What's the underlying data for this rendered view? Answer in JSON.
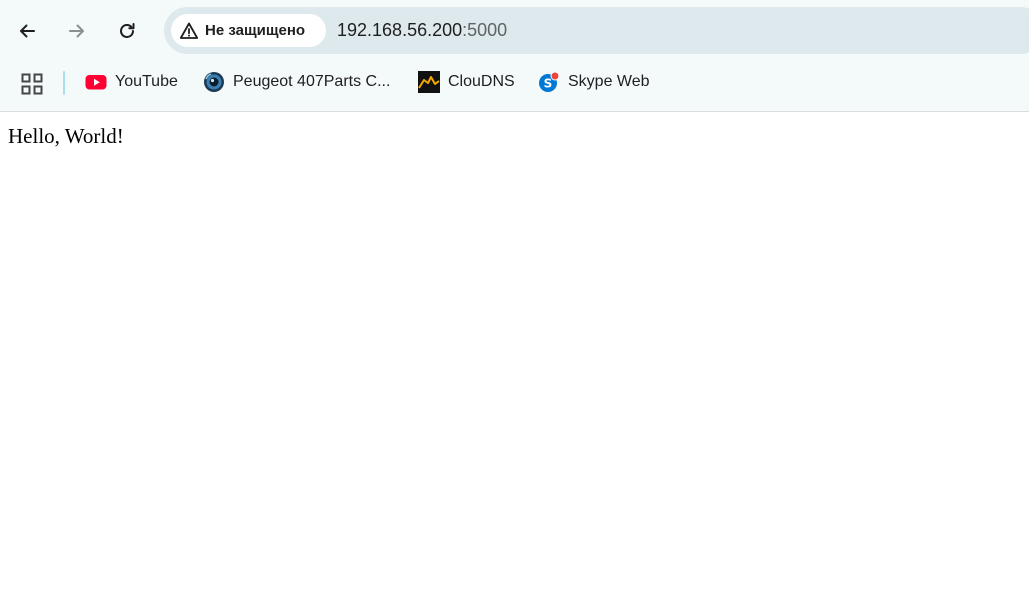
{
  "toolbar": {
    "security_label": "Не защищено",
    "url_host": "192.168.56.200",
    "url_port": ":5000"
  },
  "bookmarks": {
    "items": [
      {
        "label": "YouTube",
        "icon": "youtube-icon"
      },
      {
        "label": "Peugeot 407Parts C...",
        "icon": "peugeot-favicon"
      },
      {
        "label": "ClouDNS",
        "icon": "cloudns-favicon"
      },
      {
        "label": "Skype Web",
        "icon": "skype-icon"
      }
    ]
  },
  "page": {
    "text": "Hello, World!"
  },
  "colors": {
    "toolbar_bg": "#f4f9fa",
    "omnibox_bg": "#dde9ec",
    "youtube_red": "#ff0033",
    "skype_blue": "#0078d4"
  }
}
